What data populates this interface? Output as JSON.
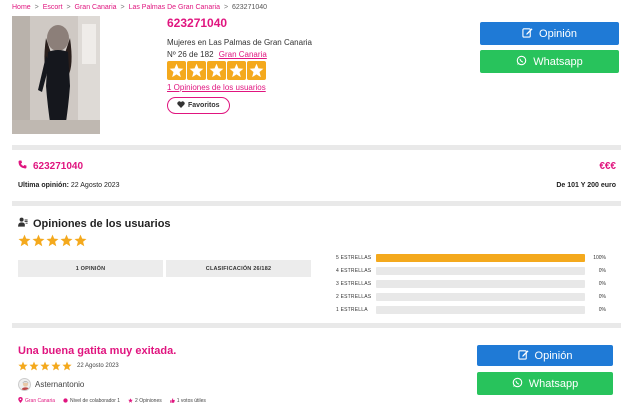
{
  "breadcrumb": {
    "items": [
      "Home",
      "Escort",
      "Gran Canaria",
      "Las Palmas De Gran Canaria"
    ],
    "current": "623271040",
    "separator": ">"
  },
  "profile": {
    "phone": "623271040",
    "category": "Mujeres en Las Palmas de Gran Canaria",
    "rank_text": "Nº 26  de 182",
    "rank_location": "Gran Canaria",
    "rating": 5,
    "opinions_link": "1 Opiniones de los usuarios",
    "favorites_label": "Favoritos"
  },
  "actions": {
    "opinion_label": "Opinión",
    "whatsapp_label": "Whatsapp"
  },
  "contact": {
    "phone": "623271040",
    "price_symbol": "€€€",
    "last_opinion_label": "Ultima opinión:",
    "last_opinion_date": "22 Agosto 2023",
    "price_range": "De 101 Y 200 euro"
  },
  "opinions": {
    "title": "Opiniones de los usuarios",
    "rating": 5,
    "count_label": "1 OPINIÓN",
    "classification_label": "CLASIFICACIÓN 26/182",
    "breakdown": [
      {
        "label": "5 ESTRELLAS",
        "percent": 100,
        "percent_text": "100%"
      },
      {
        "label": "4 ESTRELLAS",
        "percent": 0,
        "percent_text": "0%"
      },
      {
        "label": "3 ESTRELLAS",
        "percent": 0,
        "percent_text": "0%"
      },
      {
        "label": "2 ESTRELLAS",
        "percent": 0,
        "percent_text": "0%"
      },
      {
        "label": "1 ESTRELLA",
        "percent": 0,
        "percent_text": "0%"
      }
    ]
  },
  "review": {
    "title": "Una buena gatita muy exitada.",
    "rating": 5,
    "date": "22 Agosto 2023",
    "author": "Asternantonio",
    "location": "Gran Canaria",
    "level": "Nivel de colaborador 1",
    "opinions": "2 Opiniones",
    "votes": "1 votos útiles"
  },
  "colors": {
    "accent": "#e0157f",
    "star": "#f4a91d",
    "opinion_button": "#1f7ad6",
    "whatsapp_button": "#28c35c"
  }
}
